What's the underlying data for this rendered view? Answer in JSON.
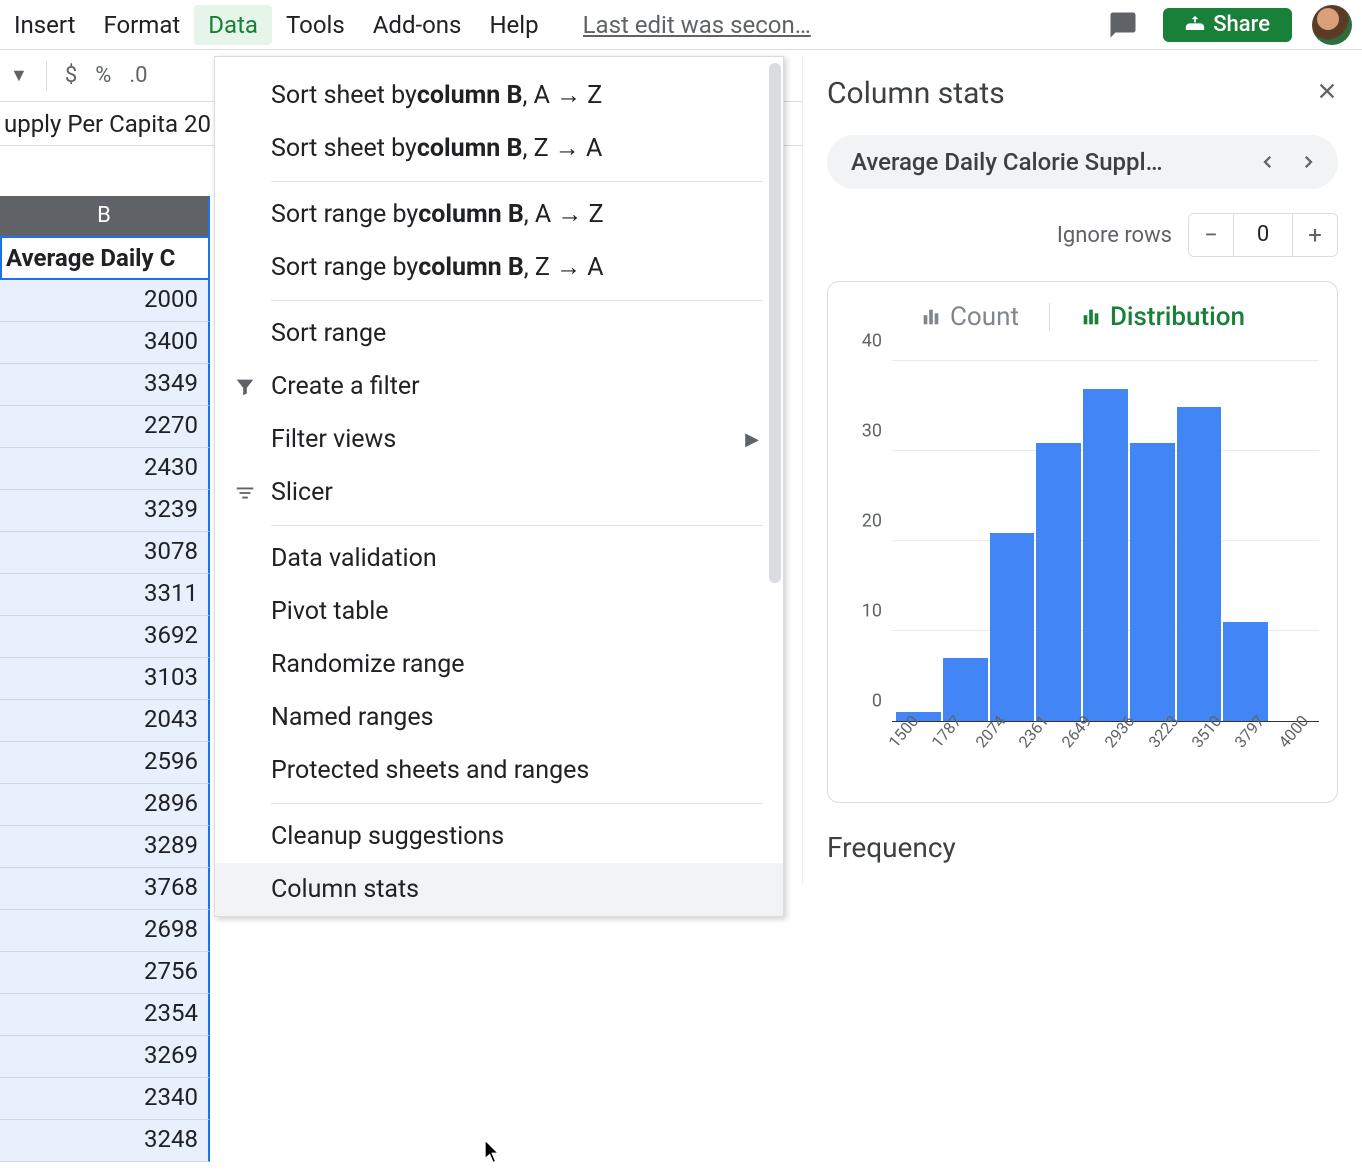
{
  "menubar": {
    "items": [
      "Insert",
      "Format",
      "Data",
      "Tools",
      "Add-ons",
      "Help"
    ],
    "active_index": 2,
    "last_edit": "Last edit was secon…",
    "share_label": "Share"
  },
  "toolbar": {
    "currency": "$",
    "percent": "%",
    "decimal": ".0"
  },
  "sheet": {
    "tab_name_fragment": "upply Per Capita 20",
    "col_letter": "B",
    "col_header_text": "Average Daily C",
    "values": [
      2000,
      3400,
      3349,
      2270,
      2430,
      3239,
      3078,
      3311,
      3692,
      3103,
      2043,
      2596,
      2896,
      3289,
      3768,
      2698,
      2756,
      2354,
      3269,
      2340,
      3248
    ]
  },
  "data_menu": {
    "sort_sheet_az_pre": "Sort sheet by ",
    "sort_sheet_az_bold": "column B",
    "sort_sheet_az_post": ", A → Z",
    "sort_sheet_za_pre": "Sort sheet by ",
    "sort_sheet_za_bold": "column B",
    "sort_sheet_za_post": ", Z → A",
    "sort_range_az_pre": "Sort range by ",
    "sort_range_az_bold": "column B",
    "sort_range_az_post": ", A → Z",
    "sort_range_za_pre": "Sort range by ",
    "sort_range_za_bold": "column B",
    "sort_range_za_post": ", Z → A",
    "sort_range": "Sort range",
    "create_filter": "Create a filter",
    "filter_views": "Filter views",
    "slicer": "Slicer",
    "data_validation": "Data validation",
    "pivot_table": "Pivot table",
    "randomize_range": "Randomize range",
    "named_ranges": "Named ranges",
    "protected": "Protected sheets and ranges",
    "cleanup": "Cleanup suggestions",
    "column_stats": "Column stats"
  },
  "colstats": {
    "title": "Column stats",
    "column_name": "Average Daily Calorie Suppl…",
    "ignore_label": "Ignore rows",
    "ignore_value": "0",
    "tab_count": "Count",
    "tab_distribution": "Distribution",
    "frequency_title": "Frequency"
  },
  "chart_data": {
    "type": "bar",
    "categories": [
      "1500",
      "1787",
      "2074",
      "2361",
      "2649",
      "2936",
      "3223",
      "3510",
      "3797",
      "4000"
    ],
    "values": [
      1,
      7,
      21,
      31,
      37,
      31,
      35,
      11,
      0
    ],
    "title": "",
    "xlabel": "",
    "ylabel": "",
    "ylim": [
      0,
      40
    ],
    "y_ticks": [
      0,
      10,
      20,
      30,
      40
    ]
  }
}
